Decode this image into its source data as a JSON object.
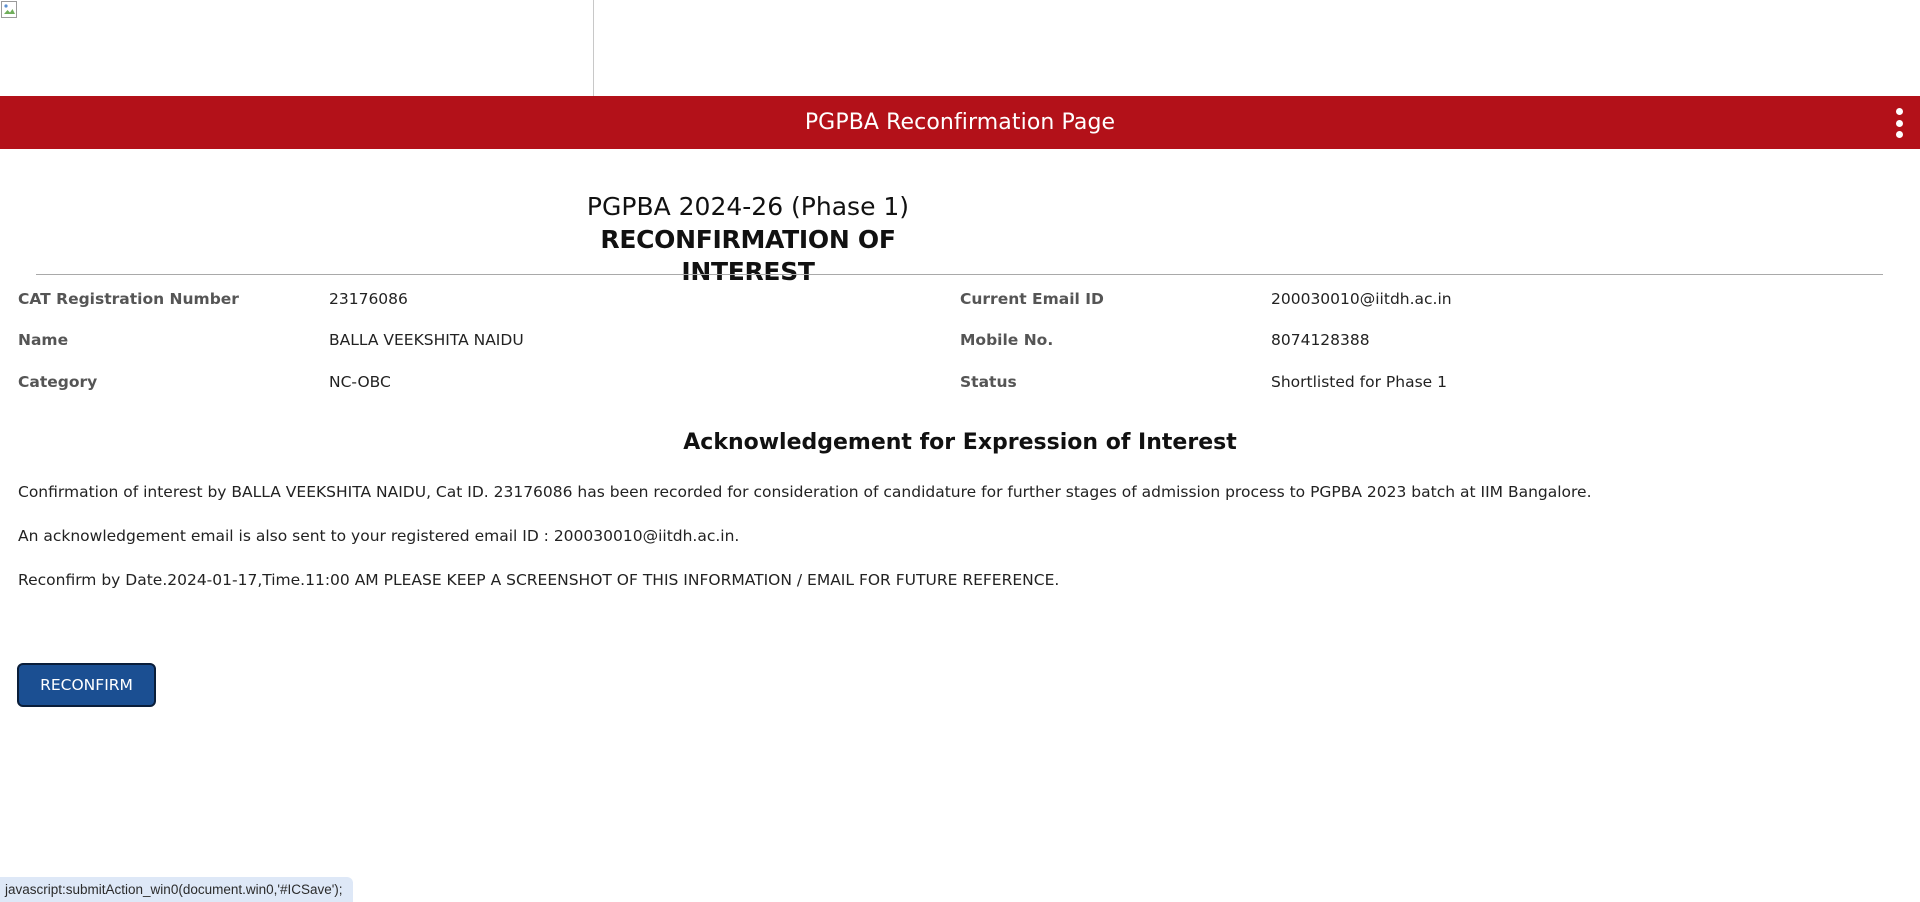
{
  "header": {
    "title": "PGPBA Reconfirmation Page",
    "menu_icon": "kebab-menu-icon"
  },
  "heading": {
    "line1": "PGPBA 2024-26 (Phase 1)",
    "line2": "RECONFIRMATION OF INTEREST"
  },
  "info": {
    "cat_label": "CAT Registration Number",
    "cat_value": "23176086",
    "name_label": "Name",
    "name_value": "BALLA VEEKSHITA NAIDU",
    "category_label": "Category",
    "category_value": "NC-OBC",
    "email_label": "Current Email ID",
    "email_value": "200030010@iitdh.ac.in",
    "mobile_label": "Mobile No.",
    "mobile_value": "8074128388",
    "status_label": "Status",
    "status_value": "Shortlisted for Phase 1"
  },
  "acknowledgement": {
    "title": "Acknowledgement for Expression of Interest",
    "para1": "Confirmation of interest by BALLA VEEKSHITA NAIDU, Cat ID. 23176086 has been recorded for consideration of candidature for further stages of admission process to PGPBA 2023 batch at IIM Bangalore.",
    "para2": "An acknowledgement email is also sent to your registered email ID : 200030010@iitdh.ac.in.",
    "para3": "Reconfirm by Date.2024-01-17,Time.11:00 AM PLEASE KEEP A SCREENSHOT OF THIS INFORMATION / EMAIL FOR FUTURE REFERENCE."
  },
  "actions": {
    "reconfirm_label": "RECONFIRM"
  },
  "statusbar": {
    "text": "javascript:submitAction_win0(document.win0,'#ICSave');"
  },
  "colors": {
    "header_bg": "#b31119",
    "button_bg": "#1b4f92",
    "statusbar_bg": "#dee8f7"
  }
}
